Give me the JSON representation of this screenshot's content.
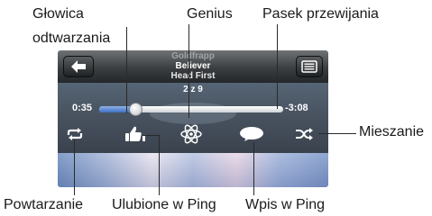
{
  "callouts": {
    "glowica_line1": "Głowica",
    "glowica_line2": "odtwarzania",
    "genius": "Genius",
    "pasek": "Pasek przewijania",
    "mieszanie": "Mieszanie",
    "powtarzanie": "Powtarzanie",
    "ulubione": "Ulubione w Ping",
    "wpis": "Wpis w Ping"
  },
  "player": {
    "artist": "Goldfrapp",
    "title": "Believer",
    "album": "Head First",
    "track_count": "2 z 9",
    "elapsed": "0:35",
    "remaining": "-3:08",
    "progress_fraction": 0.2
  },
  "icons": {
    "back": "back-arrow-icon",
    "list": "track-list-icon",
    "repeat": "repeat-icon",
    "like": "thumbs-up-icon",
    "genius": "genius-atom-icon",
    "post": "speech-bubble-icon",
    "shuffle": "shuffle-icon"
  },
  "colors": {
    "progress_fill": "#3d6fc4",
    "callout_text": "#1a1a1a"
  }
}
